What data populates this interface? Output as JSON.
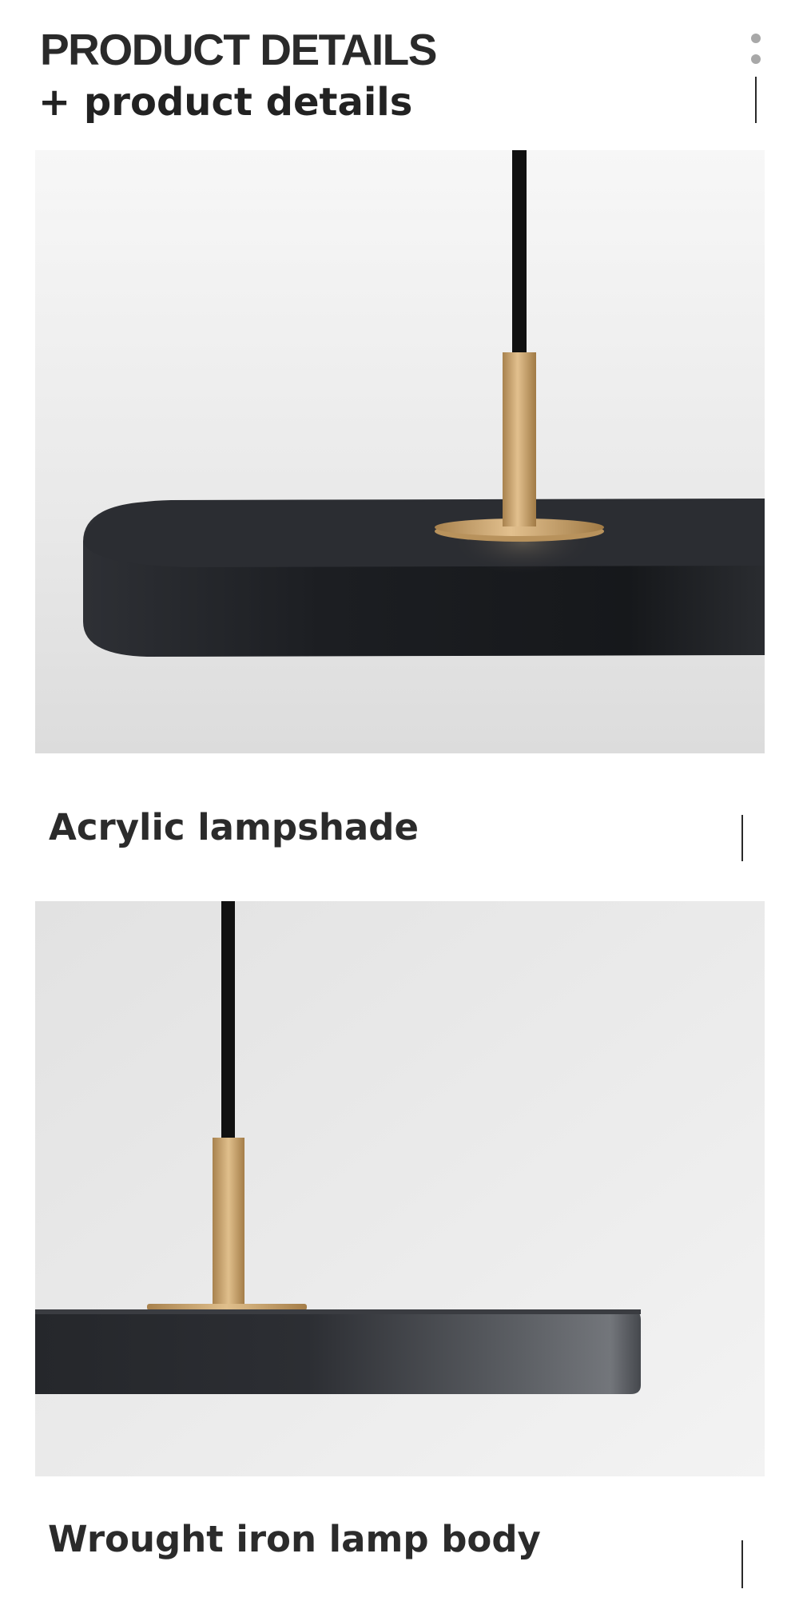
{
  "header": {
    "title": "PRODUCT DETAILS",
    "subtitle": "+ product details"
  },
  "menu": {
    "icon": "vertical-dots-icon"
  },
  "sections": [
    {
      "caption": "Acrylic lampshade",
      "image": "black-disc-pendant-lamp-top-view"
    },
    {
      "caption": "Wrought iron lamp body",
      "image": "black-disc-pendant-lamp-side-view"
    }
  ],
  "colors": {
    "text": "#2a2a2a",
    "shade": "#1f2125",
    "brass": "#c9a06a",
    "background": "#ffffff"
  }
}
